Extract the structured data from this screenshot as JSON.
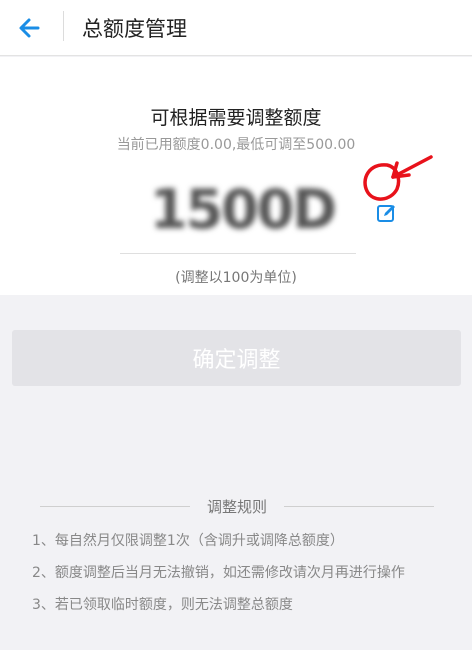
{
  "header": {
    "title": "总额度管理"
  },
  "main": {
    "heading": "可根据需要调整额度",
    "subtext": "当前已用额度0.00,最低可调至500.00",
    "amount_masked": "1500D",
    "unit_note": "(调整以100为单位)"
  },
  "button": {
    "label": "确定调整"
  },
  "rules": {
    "title": "调整规则",
    "items": [
      "1、每自然月仅限调整1次（含调升或调降总额度）",
      "2、额度调整后当月无法撤销，如还需修改请次月再进行操作",
      "3、若已领取临时额度，则无法调整总额度"
    ]
  },
  "colors": {
    "accent": "#1a8de6",
    "annotation": "#e8121b"
  },
  "icons": {
    "back": "arrow-left-icon",
    "edit": "edit-icon"
  }
}
